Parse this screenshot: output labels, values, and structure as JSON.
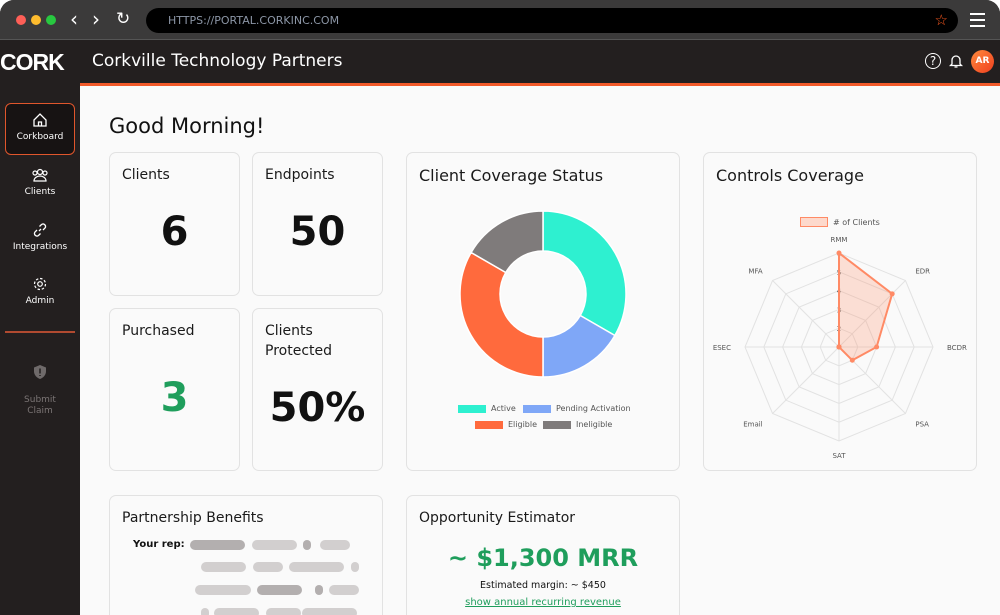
{
  "browser": {
    "url": "HTTPS://PORTAL.CORKINC.COM",
    "back": "‹",
    "forward": "›",
    "reload": "↻"
  },
  "header": {
    "logo": "CORK",
    "company": "Corkville Technology Partners",
    "avatar": "AR"
  },
  "sidebar": {
    "items": [
      {
        "label": "Corkboard",
        "icon": "home-icon",
        "active": true
      },
      {
        "label": "Clients",
        "icon": "users-icon"
      },
      {
        "label": "Integrations",
        "icon": "link-icon"
      },
      {
        "label": "Admin",
        "icon": "gear-icon"
      }
    ],
    "submit_claim": "Submit\nClaim"
  },
  "greeting": "Good Morning!",
  "stats": {
    "clients": {
      "label": "Clients",
      "value": "6"
    },
    "endpoints": {
      "label": "Endpoints",
      "value": "50"
    },
    "purchased": {
      "label": "Purchased",
      "value": "3",
      "color": "#1f9e5c"
    },
    "protected": {
      "label": "Clients Protected",
      "value": "50%"
    }
  },
  "chart_data": [
    {
      "type": "pie",
      "title": "Client Coverage Status",
      "categories": [
        "Active",
        "Pending Activation",
        "Eligible",
        "Ineligible"
      ],
      "values": [
        2,
        1,
        2,
        1
      ],
      "colors": [
        "#2ef0d0",
        "#7fa7f7",
        "#ff6a3d",
        "#7f7b7b"
      ],
      "donut": true,
      "legend": "bottom"
    },
    {
      "type": "radar",
      "title": "Controls Coverage",
      "categories": [
        "RMM",
        "EDR",
        "BCDR",
        "PSA",
        "SAT",
        "Email",
        "ESEC",
        "MFA"
      ],
      "series": [
        {
          "name": "# of Clients",
          "values": [
            6,
            5,
            3,
            2,
            1,
            1,
            1,
            1
          ]
        }
      ],
      "rlim": [
        1,
        6
      ],
      "ticks": [
        "2",
        "3",
        "4",
        "5",
        "6"
      ],
      "color": "#ff8a65",
      "legend": "top"
    }
  ],
  "partnership": {
    "title": "Partnership Benefits",
    "rep_label": "Your rep:"
  },
  "opportunity": {
    "title": "Opportunity Estimator",
    "mrr": "~ $1,300 MRR",
    "margin": "Estimated margin: ~ $450",
    "link": "show annual recurring revenue"
  }
}
